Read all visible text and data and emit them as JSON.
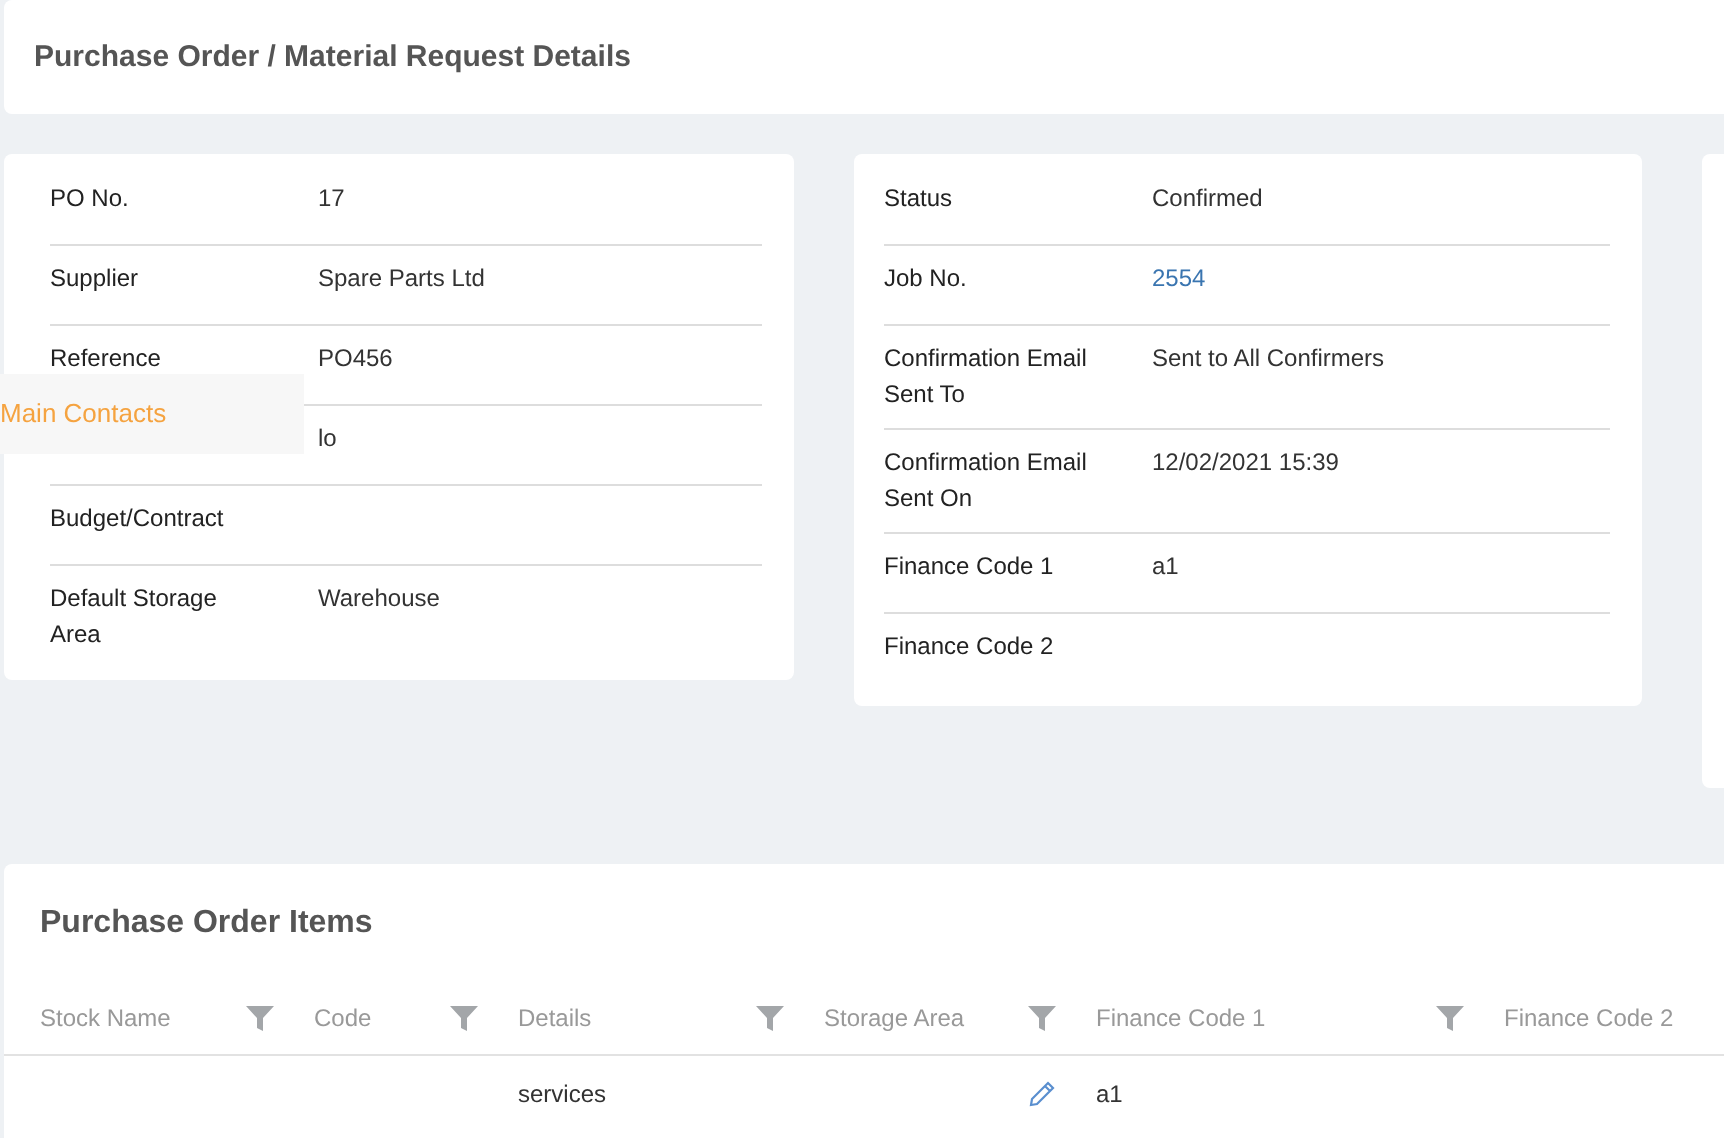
{
  "page_title": "Purchase Order / Material Request Details",
  "left_details": [
    {
      "label": "PO No.",
      "value": "17"
    },
    {
      "label": "Supplier",
      "value": "Spare Parts Ltd"
    },
    {
      "label": "Reference",
      "value": "PO456"
    },
    {
      "value": "lo"
    },
    {
      "label": "Budget/Contract"
    },
    {
      "label": "Default Storage Area",
      "value": "Warehouse"
    }
  ],
  "right_details": [
    {
      "label": "Status",
      "value": "Confirmed"
    },
    {
      "label": "Job No.",
      "value": "2554",
      "kind": "link"
    },
    {
      "label": "Confirmation Email Sent To",
      "value": "Sent to All Confirmers"
    },
    {
      "label": "Confirmation Email Sent On",
      "value": "12/02/2021 15:39"
    },
    {
      "label": "Finance Code 1",
      "value": "a1"
    },
    {
      "label": "Finance Code 2"
    }
  ],
  "overlay_menu": {
    "label": "Main Contacts"
  },
  "items": {
    "title": "Purchase Order Items",
    "columns": [
      {
        "label": "Stock Name",
        "filter": true
      },
      {
        "label": "Code",
        "filter": true
      },
      {
        "label": "Details",
        "filter": true
      },
      {
        "label": "Storage Area",
        "filter": true
      },
      {
        "label": "Finance Code 1",
        "filter": true
      },
      {
        "label": "Finance Code 2",
        "filter": false
      }
    ],
    "rows": [
      {
        "cells": [
          "",
          "",
          "services",
          "",
          "a1",
          ""
        ],
        "editable": true
      }
    ]
  }
}
